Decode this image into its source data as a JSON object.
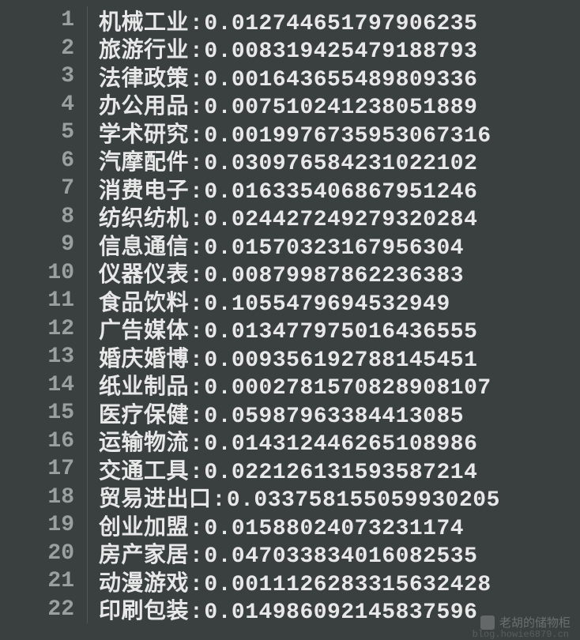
{
  "lines": [
    {
      "n": "1",
      "category": "机械工业",
      "value": "0.012744651797906235"
    },
    {
      "n": "2",
      "category": "旅游行业",
      "value": "0.008319425479188793"
    },
    {
      "n": "3",
      "category": "法律政策",
      "value": "0.001643655489809336"
    },
    {
      "n": "4",
      "category": "办公用品",
      "value": "0.007510241238051889"
    },
    {
      "n": "5",
      "category": "学术研究",
      "value": "0.0019976735953067316"
    },
    {
      "n": "6",
      "category": "汽摩配件",
      "value": "0.030976584231022102"
    },
    {
      "n": "7",
      "category": "消费电子",
      "value": "0.016335406867951246"
    },
    {
      "n": "8",
      "category": "纺织纺机",
      "value": "0.024427249279320284"
    },
    {
      "n": "9",
      "category": "信息通信",
      "value": "0.01570323167956304"
    },
    {
      "n": "10",
      "category": "仪器仪表",
      "value": "0.00879987862236383"
    },
    {
      "n": "11",
      "category": "食品饮料",
      "value": "0.1055479694532949"
    },
    {
      "n": "12",
      "category": "广告媒体",
      "value": "0.013477975016436555"
    },
    {
      "n": "13",
      "category": "婚庆婚博",
      "value": "0.009356192788145451"
    },
    {
      "n": "14",
      "category": "纸业制品",
      "value": "0.0002781570828908107"
    },
    {
      "n": "15",
      "category": "医疗保健",
      "value": "0.05987963384413085"
    },
    {
      "n": "16",
      "category": "运输物流",
      "value": "0.014312446265108986"
    },
    {
      "n": "17",
      "category": "交通工具",
      "value": "0.022126131593587214"
    },
    {
      "n": "18",
      "category": "贸易进出口",
      "value": "0.033758155059930205"
    },
    {
      "n": "19",
      "category": "创业加盟",
      "value": "0.01588024073231174"
    },
    {
      "n": "20",
      "category": "房产家居",
      "value": "0.047033834016082535"
    },
    {
      "n": "21",
      "category": "动漫游戏",
      "value": "0.0011126283315632428"
    },
    {
      "n": "22",
      "category": "印刷包装",
      "value": "0.014986092145837596"
    }
  ],
  "separator": ":",
  "watermark": {
    "text": "老胡的储物柜",
    "url": "blog.howie6879.cn"
  }
}
